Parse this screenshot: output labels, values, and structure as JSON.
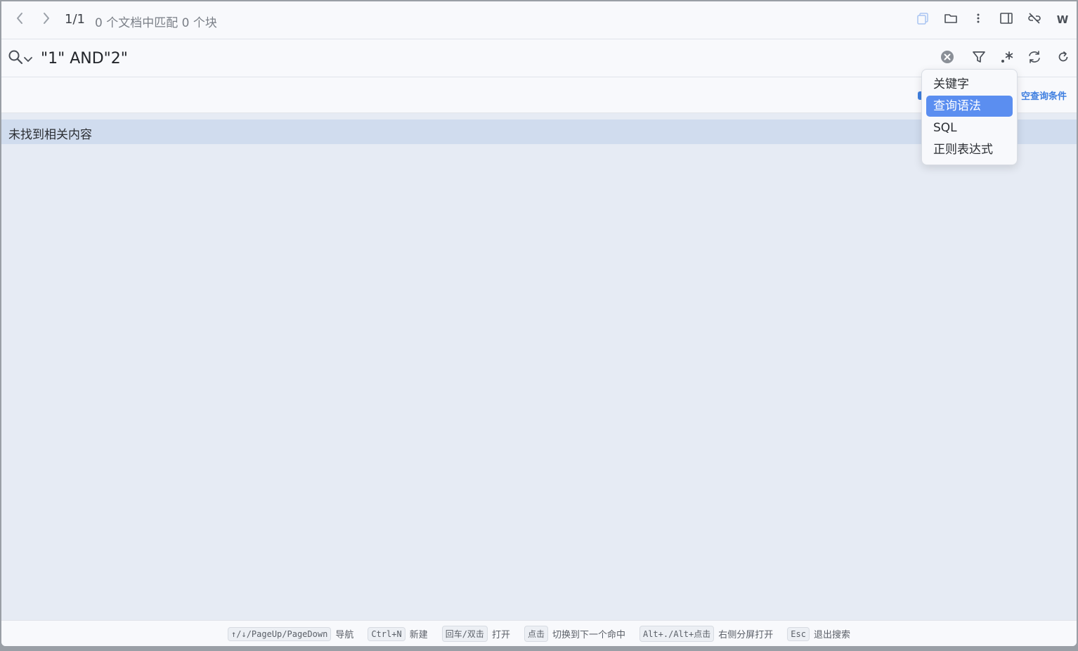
{
  "topbar": {
    "counter": "1/1",
    "match_info": "0 个文档中匹配 0 个块",
    "right_letter": "W",
    "icons": [
      "chevron-left-icon",
      "chevron-right-icon",
      "copy-icon",
      "folder-icon",
      "more-icon",
      "sidebar-panel-icon",
      "unlink-icon"
    ]
  },
  "search": {
    "value": "\"1\" AND\"2\"",
    "icons": [
      "search-icon",
      "chevron-down-icon",
      "clear-icon",
      "filter-icon",
      "regex-icon",
      "replace-icon",
      "refresh-icon"
    ]
  },
  "filter": {
    "clear_label": "空查询条件"
  },
  "results": {
    "empty_text": "未找到相关内容"
  },
  "dropdown": {
    "items": [
      {
        "label": "关键字",
        "active": false
      },
      {
        "label": "查询语法",
        "active": true
      },
      {
        "label": "SQL",
        "active": false
      },
      {
        "label": "正则表达式",
        "active": false
      }
    ]
  },
  "footer": {
    "hints": [
      {
        "key": "↑/↓/PageUp/PageDown",
        "text": "导航"
      },
      {
        "key": "Ctrl+N",
        "text": "新建"
      },
      {
        "key": "回车/双击",
        "text": "打开"
      },
      {
        "key": "点击",
        "text": "切换到下一个命中"
      },
      {
        "key": "Alt+./Alt+点击",
        "text": "右侧分屏打开"
      },
      {
        "key": "Esc",
        "text": "退出搜索"
      }
    ]
  },
  "colors": {
    "accent": "#5b8ef0",
    "link": "#3f7fe0",
    "result_bg": "#d0dcee",
    "panel_bg": "#e6ebf4"
  }
}
